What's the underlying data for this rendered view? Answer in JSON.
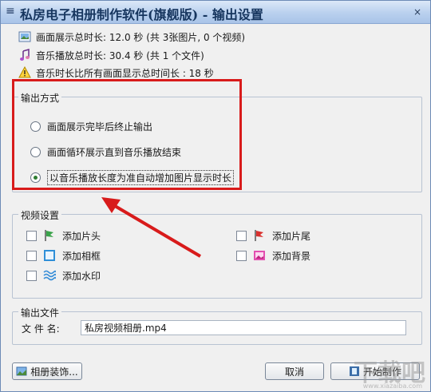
{
  "window": {
    "title": "私房电子相册制作软件(旗舰版) - 输出设置",
    "close_symbol": "×"
  },
  "info": {
    "image_duration": "画面展示总时长: 12.0 秒 (共 3张图片, 0 个视频)",
    "music_duration": "音乐播放总时长: 30.4 秒 (共 1 个文件)",
    "warning": "音乐时长比所有画面显示总时间长 : 18 秒"
  },
  "output_mode": {
    "group_title": "输出方式",
    "options": [
      {
        "label": "画面展示完毕后终止输出",
        "selected": false
      },
      {
        "label": "画面循环展示直到音乐播放结束",
        "selected": false
      },
      {
        "label": "以音乐播放长度为准自动增加图片显示时长",
        "selected": true
      }
    ]
  },
  "video_settings": {
    "group_title": "视频设置",
    "add_intro": "添加片头",
    "add_outro": "添加片尾",
    "add_frame": "添加相框",
    "add_background": "添加背景",
    "add_watermark": "添加水印"
  },
  "output_file": {
    "group_title": "输出文件",
    "file_label": "文 件 名:",
    "file_value": "私房视频相册.mp4"
  },
  "buttons": {
    "decorate": "相册装饰...",
    "cancel": "取消",
    "start": "开始制作"
  },
  "watermark": {
    "logo": "下载吧",
    "url": "www.xiazaiba.com"
  },
  "colors": {
    "annotation": "#d81b1b",
    "title_text": "#16355e"
  }
}
